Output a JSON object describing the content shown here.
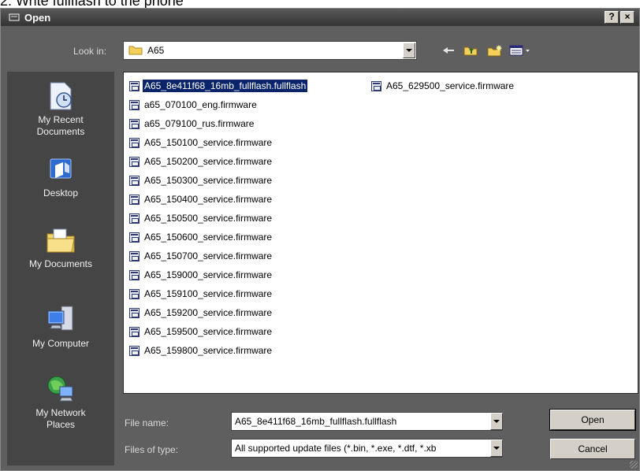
{
  "page": {
    "heading": "2. Write fullflash to the phone"
  },
  "window": {
    "title": "Open",
    "help_label": "?",
    "close_label": "×"
  },
  "lookin": {
    "label": "Look in:",
    "value": "A65"
  },
  "places": [
    {
      "label": "My Recent Documents",
      "icon": "recent-documents-icon"
    },
    {
      "label": "Desktop",
      "icon": "desktop-icon"
    },
    {
      "label": "My Documents",
      "icon": "my-documents-icon"
    },
    {
      "label": "My Computer",
      "icon": "my-computer-icon"
    },
    {
      "label": "My Network Places",
      "icon": "network-places-icon"
    }
  ],
  "files": [
    {
      "name": "A65_8e411f68_16mb_fullflash.fullflash",
      "selected": true
    },
    {
      "name": "A65_629500_service.firmware"
    },
    {
      "name": "a65_070100_eng.firmware"
    },
    {
      "name": "a65_079100_rus.firmware"
    },
    {
      "name": "A65_150100_service.firmware"
    },
    {
      "name": "A65_150200_service.firmware"
    },
    {
      "name": "A65_150300_service.firmware"
    },
    {
      "name": "A65_150400_service.firmware"
    },
    {
      "name": "A65_150500_service.firmware"
    },
    {
      "name": "A65_150600_service.firmware"
    },
    {
      "name": "A65_150700_service.firmware"
    },
    {
      "name": "A65_159000_service.firmware"
    },
    {
      "name": "A65_159100_service.firmware"
    },
    {
      "name": "A65_159200_service.firmware"
    },
    {
      "name": "A65_159500_service.firmware"
    },
    {
      "name": "A65_159800_service.firmware"
    }
  ],
  "filename": {
    "label": "File name:",
    "value": "A65_8e411f68_16mb_fullflash.fullflash"
  },
  "filetype": {
    "label": "Files of type:",
    "value": "All supported update files (*.bin, *.exe, *.dtf, *.xb"
  },
  "buttons": {
    "open": "Open",
    "cancel": "Cancel"
  },
  "colors": {
    "selection": "#0a246a",
    "dialog_bg": "#5f5f5f",
    "places_bg": "#454545"
  }
}
